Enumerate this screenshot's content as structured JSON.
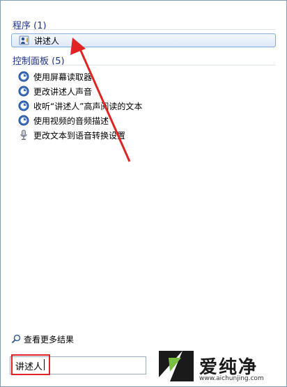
{
  "programs": {
    "title": "程序 (1)",
    "items": [
      {
        "label": "讲述人",
        "icon": "narrator-icon"
      }
    ]
  },
  "control_panel": {
    "title": "控制面板 (5)",
    "items": [
      {
        "label": "使用屏幕读取器",
        "icon": "ease-of-access-icon"
      },
      {
        "label": "更改讲述人声音",
        "icon": "ease-of-access-icon"
      },
      {
        "label": "收听“讲述人”高声阅读的文本",
        "icon": "ease-of-access-icon"
      },
      {
        "label": "使用视频的音频描述",
        "icon": "ease-of-access-icon"
      },
      {
        "label": "更改文本到语音转换设置",
        "icon": "microphone-icon"
      }
    ]
  },
  "footer": {
    "more_results": "查看更多结果",
    "search_value": "讲述人"
  },
  "watermark": {
    "brand": "爱纯净",
    "url": "www.aichunjing.com"
  },
  "colors": {
    "section_title": "#1e3287",
    "selection_border": "#84acdd",
    "highlight_red": "#e02424"
  }
}
